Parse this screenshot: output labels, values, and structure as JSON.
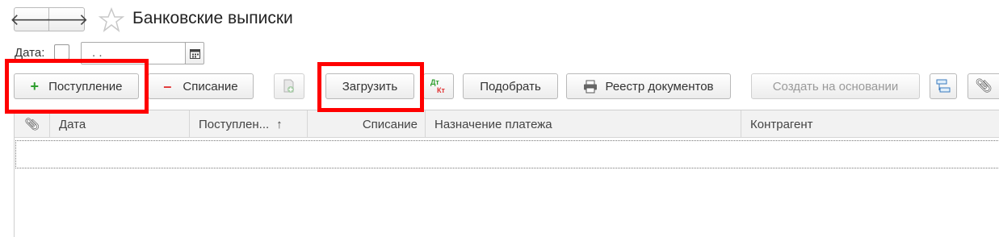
{
  "window": {
    "title": "Банковские выписки",
    "nav_back": "🡐",
    "nav_forward": "🡒"
  },
  "filter": {
    "date_label": "Дата:",
    "date_value": ". ."
  },
  "toolbar": {
    "receipt_label": "Поступление",
    "writeoff_label": "Списание",
    "load_label": "Загрузить",
    "dt_label": "Дт",
    "kt_label": "Кт",
    "select_label": "Подобрать",
    "registry_label": "Реестр документов",
    "create_based_label": "Создать на основании"
  },
  "table": {
    "columns": [
      "Дата",
      "Поступлен...",
      "Списание",
      "Назначение платежа",
      "Контрагент"
    ],
    "sort_indicator": "↑"
  },
  "colors": {
    "highlight": "#ff0000",
    "plus": "#2e9e2e",
    "minus": "#e03030"
  }
}
